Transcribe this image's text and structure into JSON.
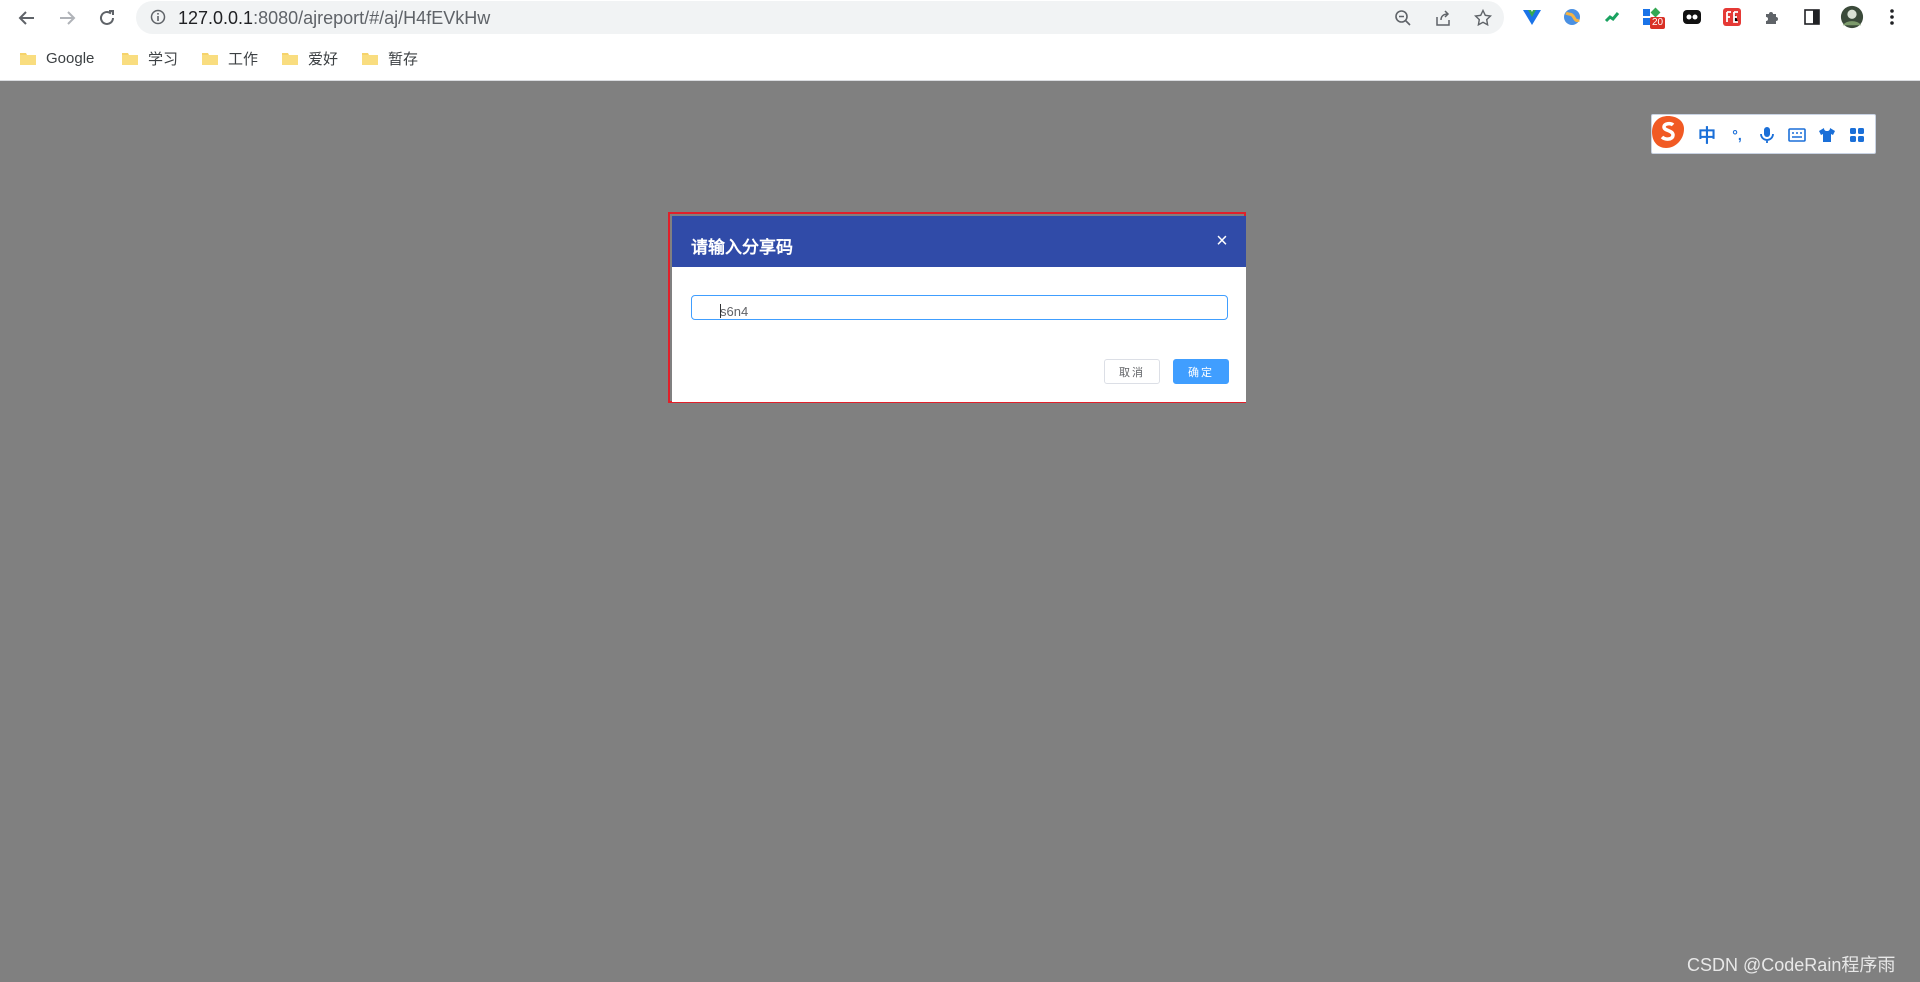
{
  "browser": {
    "url_host": "127.0.0.1",
    "url_rest": ":8080/ajreport/#/aj/H4fEVkHw",
    "extension_badge": "20",
    "bookmarks": [
      {
        "label": "Google"
      },
      {
        "label": "学习"
      },
      {
        "label": "工作"
      },
      {
        "label": "爱好"
      },
      {
        "label": "暂存"
      }
    ]
  },
  "ime_toolbar": {
    "mode_label": "中",
    "punct_label": "°,"
  },
  "dialog": {
    "title": "请输入分享码",
    "close_label": "×",
    "input_value": "s6n4",
    "cancel_label": "取消",
    "confirm_label": "确定"
  },
  "watermark": "CSDN @CodeRain程序雨",
  "colors": {
    "dialog_header": "#304ba8",
    "primary_button": "#409eff",
    "highlight_border": "#e0202a",
    "overlay": "#808080"
  }
}
